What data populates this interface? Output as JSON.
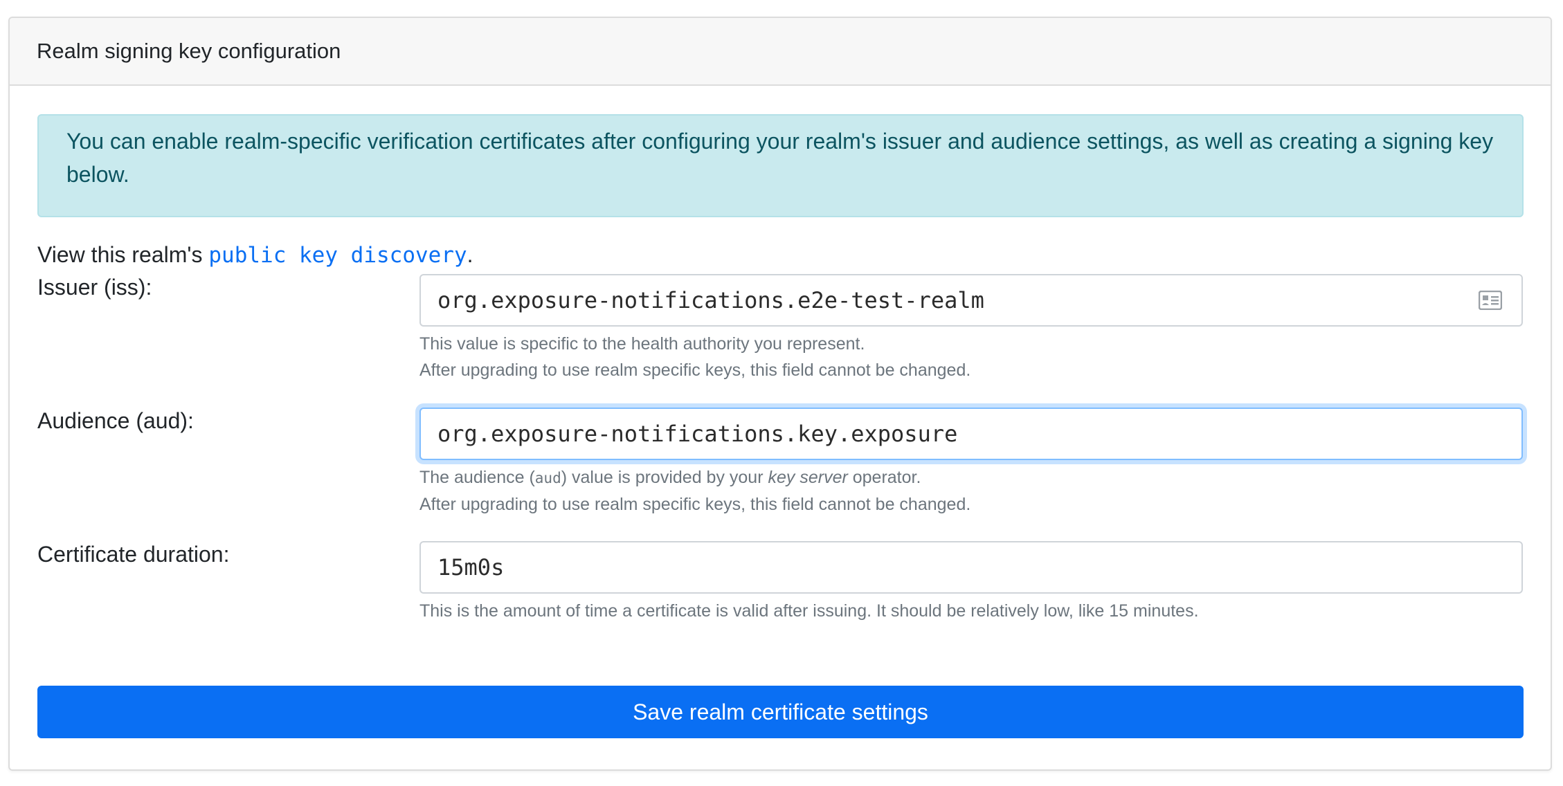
{
  "card": {
    "title": "Realm signing key configuration"
  },
  "alert": {
    "text": "You can enable realm-specific verification certificates after configuring your realm's issuer and audience settings, as well as creating a signing key below."
  },
  "discovery": {
    "prefix": "View this realm's ",
    "link": "public key discovery",
    "suffix": "."
  },
  "issuer": {
    "label": "Issuer (iss):",
    "value": "org.exposure-notifications.e2e-test-realm",
    "icon": "contact-card-icon",
    "help_line1": "This value is specific to the health authority you represent.",
    "help_line2": "After upgrading to use realm specific keys, this field cannot be changed."
  },
  "audience": {
    "label": "Audience (aud):",
    "value": "org.exposure-notifications.key.exposure",
    "help_prefix": "The audience (",
    "help_code": "aud",
    "help_middle": ") value is provided by your ",
    "help_em": "key server",
    "help_suffix": " operator.",
    "help_line2": "After upgrading to use realm specific keys, this field cannot be changed."
  },
  "duration": {
    "label": "Certificate duration:",
    "value": "15m0s",
    "help": "This is the amount of time a certificate is valid after issuing. It should be relatively low, like 15 minutes."
  },
  "save_button": {
    "label": "Save realm certificate settings"
  },
  "colors": {
    "primary": "#0a6ff3",
    "alert_bg": "#c9eaee",
    "alert_text": "#0c5460",
    "focus_border": "#80bdff"
  }
}
